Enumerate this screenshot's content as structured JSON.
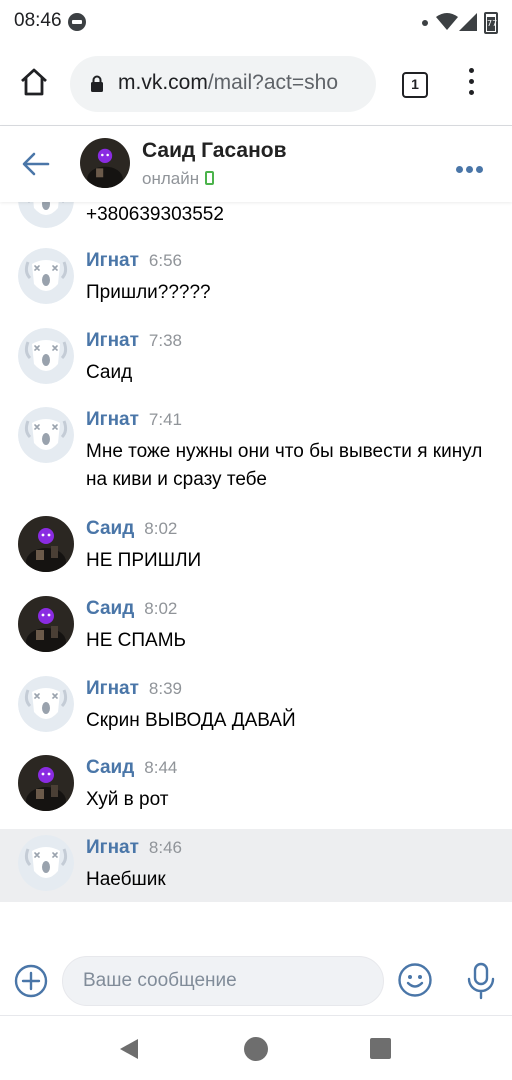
{
  "status_bar": {
    "time": "08:46",
    "battery": "77"
  },
  "browser": {
    "url_host": "m.vk.com",
    "url_path": "/mail?act=sho",
    "tab_count": "1"
  },
  "chat": {
    "name": "Саид Гасанов",
    "status": "онлайн"
  },
  "colors": {
    "accent": "#4a76a8",
    "online": "#4bb34b",
    "highlight": "#edeef0"
  },
  "messages": {
    "partial": {
      "text": "+380639303552",
      "avatar": "dog-avatar"
    },
    "items": [
      {
        "name": "Игнат",
        "time": "6:56",
        "text": "Пришли?????",
        "avatar": "dog-avatar"
      },
      {
        "name": "Игнат",
        "time": "7:38",
        "text": "Саид",
        "avatar": "dog-avatar"
      },
      {
        "name": "Игнат",
        "time": "7:41",
        "text": "Мне тоже нужны они что бы вывести я кинул на киви и сразу тебе",
        "avatar": "dog-avatar"
      },
      {
        "name": "Саид",
        "time": "8:02",
        "text": "НЕ ПРИШЛИ",
        "avatar": "photo-avatar"
      },
      {
        "name": "Саид",
        "time": "8:02",
        "text": "НЕ СПАМЬ",
        "avatar": "photo-avatar"
      },
      {
        "name": "Игнат",
        "time": "8:39",
        "text": "Скрин ВЫВОДА ДАВАЙ",
        "avatar": "dog-avatar"
      },
      {
        "name": "Саид",
        "time": "8:44",
        "text": "Хуй в рот",
        "avatar": "photo-avatar"
      },
      {
        "name": "Игнат",
        "time": "8:46",
        "text": "Наебшик",
        "avatar": "dog-avatar"
      }
    ]
  },
  "composer": {
    "placeholder": "Ваше сообщение"
  }
}
